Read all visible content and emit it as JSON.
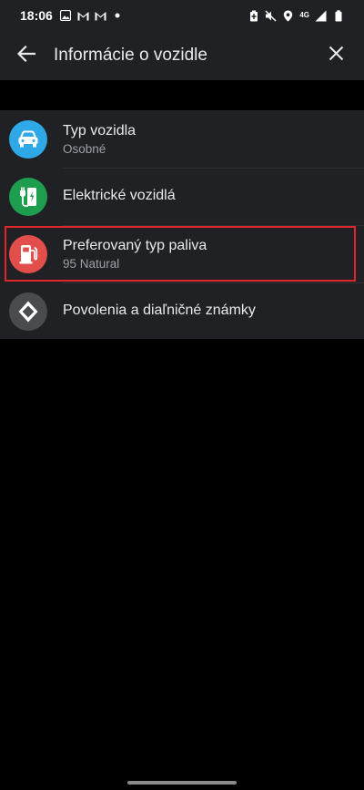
{
  "status_bar": {
    "time": "18:06",
    "network": "4G"
  },
  "app_bar": {
    "title": "Informácie o vozidle",
    "back_icon": "arrow-left-icon",
    "close_icon": "close-icon"
  },
  "list": {
    "items": [
      {
        "title": "Typ vozidla",
        "subtitle": "Osobné",
        "icon": "car-icon",
        "icon_color": "#2fa8e8"
      },
      {
        "title": "Elektrické vozidlá",
        "subtitle": "",
        "icon": "ev-charger-icon",
        "icon_color": "#1e9d4f"
      },
      {
        "title": "Preferovaný typ paliva",
        "subtitle": "95 Natural",
        "icon": "fuel-pump-icon",
        "icon_color": "#e24e4b"
      },
      {
        "title": "Povolenia a diaľničné známky",
        "subtitle": "",
        "icon": "diamond-sign-icon",
        "icon_color": "#4a4b4f"
      }
    ]
  },
  "colors": {
    "background": "#000000",
    "surface": "#202124",
    "highlight": "#e0262a"
  }
}
